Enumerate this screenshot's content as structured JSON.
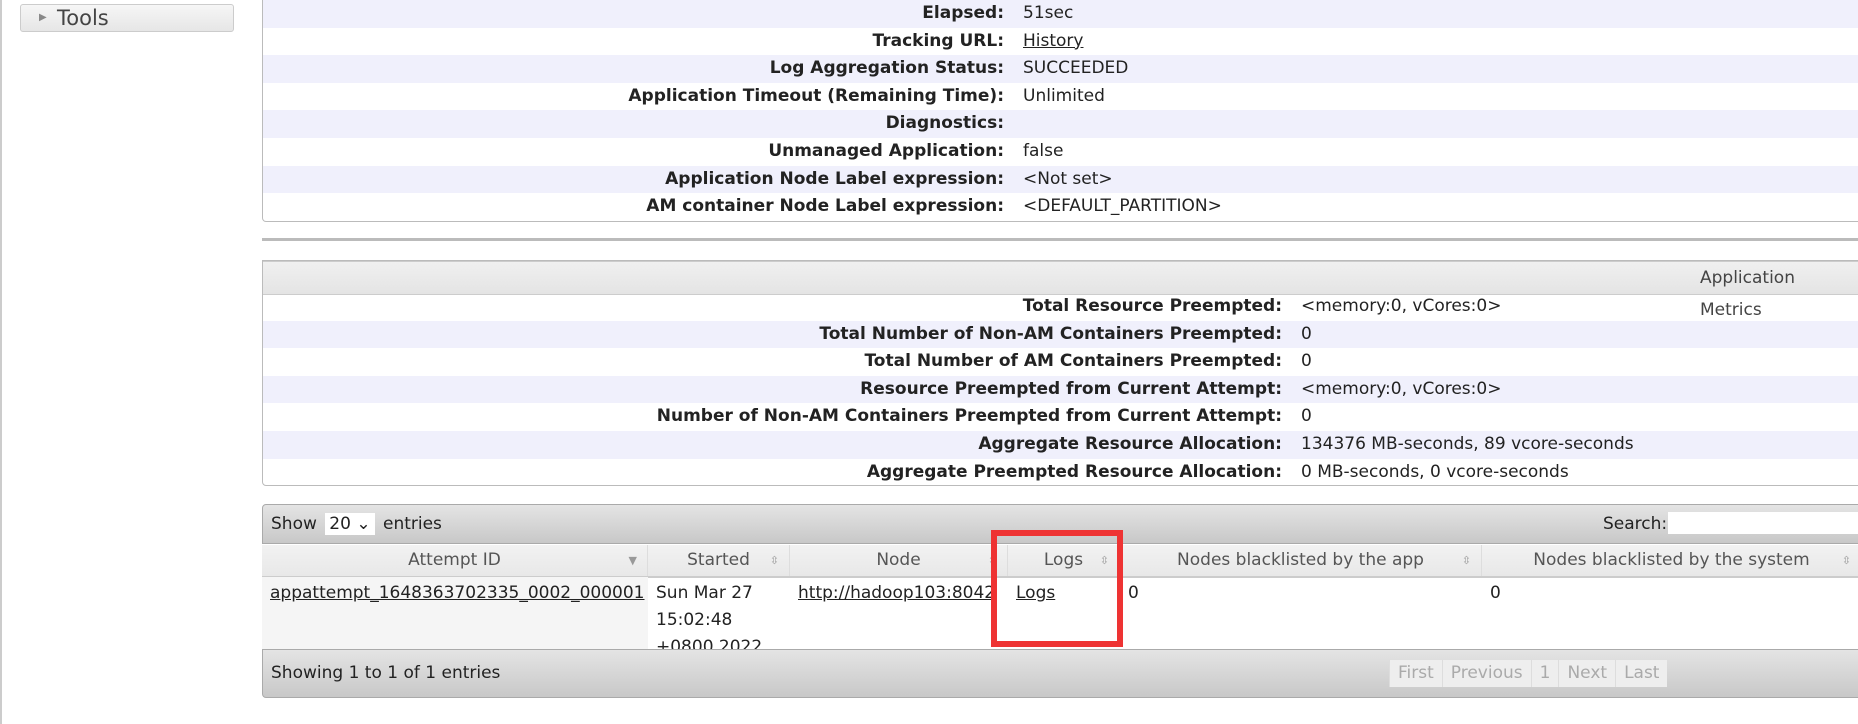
{
  "sidebar": {
    "tools_label": "Tools"
  },
  "app_info": {
    "rows": [
      {
        "label": "Elapsed:",
        "value": "51sec"
      },
      {
        "label": "Tracking URL:",
        "value": "History",
        "link": true
      },
      {
        "label": "Log Aggregation Status:",
        "value": "SUCCEEDED"
      },
      {
        "label": "Application Timeout (Remaining Time):",
        "value": "Unlimited"
      },
      {
        "label": "Diagnostics:",
        "value": ""
      },
      {
        "label": "Unmanaged Application:",
        "value": "false"
      },
      {
        "label": "Application Node Label expression:",
        "value": "<Not set>"
      },
      {
        "label": "AM container Node Label expression:",
        "value": "<DEFAULT_PARTITION>"
      }
    ]
  },
  "metrics": {
    "title": "Application Metrics",
    "rows": [
      {
        "label": "Total Resource Preempted:",
        "value": "<memory:0, vCores:0>"
      },
      {
        "label": "Total Number of Non-AM Containers Preempted:",
        "value": "0"
      },
      {
        "label": "Total Number of AM Containers Preempted:",
        "value": "0"
      },
      {
        "label": "Resource Preempted from Current Attempt:",
        "value": "<memory:0, vCores:0>"
      },
      {
        "label": "Number of Non-AM Containers Preempted from Current Attempt:",
        "value": "0"
      },
      {
        "label": "Aggregate Resource Allocation:",
        "value": "134376 MB-seconds, 89 vcore-seconds"
      },
      {
        "label": "Aggregate Preempted Resource Allocation:",
        "value": "0 MB-seconds, 0 vcore-seconds"
      }
    ]
  },
  "attempts": {
    "show_label": "Show",
    "entries_label": "entries",
    "page_size": "20",
    "search_label": "Search:",
    "search_value": "",
    "columns": [
      "Attempt ID",
      "Started",
      "Node",
      "Logs",
      "Nodes blacklisted by the app",
      "Nodes blacklisted by the system"
    ],
    "rows": [
      {
        "attempt_id": "appattempt_1648363702335_0002_000001",
        "started_1": "Sun Mar 27",
        "started_2": "15:02:48",
        "started_3": "+0800 2022",
        "node": "http://hadoop103:8042",
        "logs": "Logs",
        "bl_app": "0",
        "bl_system": "0"
      }
    ],
    "info": "Showing 1 to 1 of 1 entries",
    "pagination": [
      "First",
      "Previous",
      "1",
      "Next",
      "Last"
    ]
  },
  "highlight_color": "#ee3333"
}
